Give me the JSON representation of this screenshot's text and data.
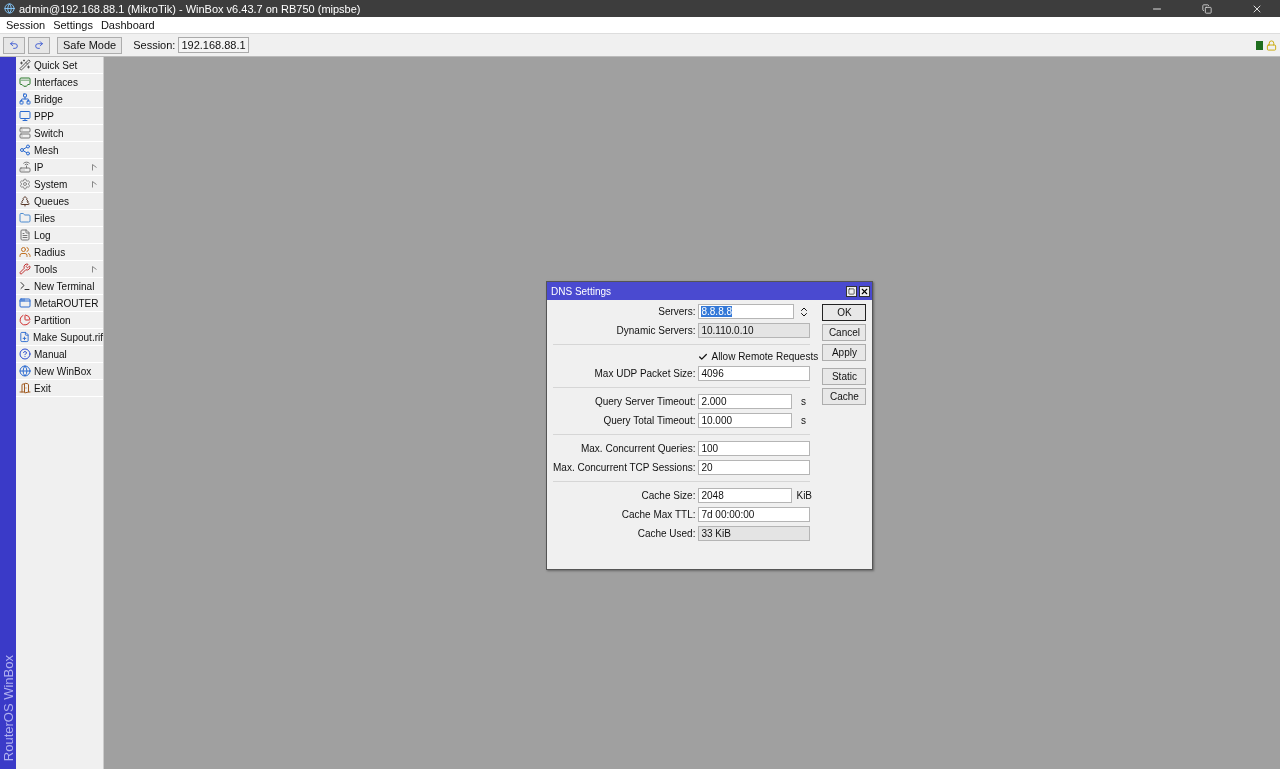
{
  "window": {
    "title": "admin@192.168.88.1 (MikroTik) - WinBox v6.43.7 on RB750 (mipsbe)"
  },
  "menu": [
    "Session",
    "Settings",
    "Dashboard"
  ],
  "toolbar": {
    "safe_mode": "Safe Mode",
    "session_label": "Session:",
    "session_value": "192.168.88.1"
  },
  "sidebar": {
    "brand": "RouterOS WinBox",
    "items": [
      {
        "label": "Quick Set",
        "submenu": false
      },
      {
        "label": "Interfaces",
        "submenu": false
      },
      {
        "label": "Bridge",
        "submenu": false
      },
      {
        "label": "PPP",
        "submenu": false
      },
      {
        "label": "Switch",
        "submenu": false
      },
      {
        "label": "Mesh",
        "submenu": false
      },
      {
        "label": "IP",
        "submenu": true
      },
      {
        "label": "System",
        "submenu": true
      },
      {
        "label": "Queues",
        "submenu": false
      },
      {
        "label": "Files",
        "submenu": false
      },
      {
        "label": "Log",
        "submenu": false
      },
      {
        "label": "Radius",
        "submenu": false
      },
      {
        "label": "Tools",
        "submenu": true
      },
      {
        "label": "New Terminal",
        "submenu": false
      },
      {
        "label": "MetaROUTER",
        "submenu": false
      },
      {
        "label": "Partition",
        "submenu": false
      },
      {
        "label": "Make Supout.rif",
        "submenu": false
      },
      {
        "label": "Manual",
        "submenu": false
      },
      {
        "label": "New WinBox",
        "submenu": false
      },
      {
        "label": "Exit",
        "submenu": false
      }
    ]
  },
  "dialog": {
    "title": "DNS Settings",
    "rows": [
      {
        "kind": "list",
        "label": "Servers:",
        "value": "8.8.8.8",
        "selected": true
      },
      {
        "kind": "readonly",
        "label": "Dynamic Servers:",
        "value": "10.110.0.10"
      },
      {
        "kind": "separator"
      },
      {
        "kind": "checkbox",
        "label": "Allow Remote Requests",
        "checked": true
      },
      {
        "kind": "field",
        "label": "Max UDP Packet Size:",
        "value": "4096"
      },
      {
        "kind": "separator"
      },
      {
        "kind": "field",
        "label": "Query Server Timeout:",
        "value": "2.000",
        "unit": "s"
      },
      {
        "kind": "field",
        "label": "Query Total Timeout:",
        "value": "10.000",
        "unit": "s"
      },
      {
        "kind": "separator"
      },
      {
        "kind": "field",
        "label": "Max. Concurrent Queries:",
        "value": "100"
      },
      {
        "kind": "field",
        "label": "Max. Concurrent TCP Sessions:",
        "value": "20"
      },
      {
        "kind": "separator"
      },
      {
        "kind": "field",
        "label": "Cache Size:",
        "value": "2048",
        "unit": "KiB"
      },
      {
        "kind": "field",
        "label": "Cache Max TTL:",
        "value": "7d 00:00:00"
      },
      {
        "kind": "readonly",
        "label": "Cache Used:",
        "value": "33 KiB"
      }
    ],
    "button_groups": [
      [
        {
          "label": "OK",
          "default": true
        },
        {
          "label": "Cancel",
          "default": false
        },
        {
          "label": "Apply",
          "default": false
        }
      ],
      [
        {
          "label": "Static",
          "default": false
        },
        {
          "label": "Cache",
          "default": false
        }
      ]
    ]
  }
}
